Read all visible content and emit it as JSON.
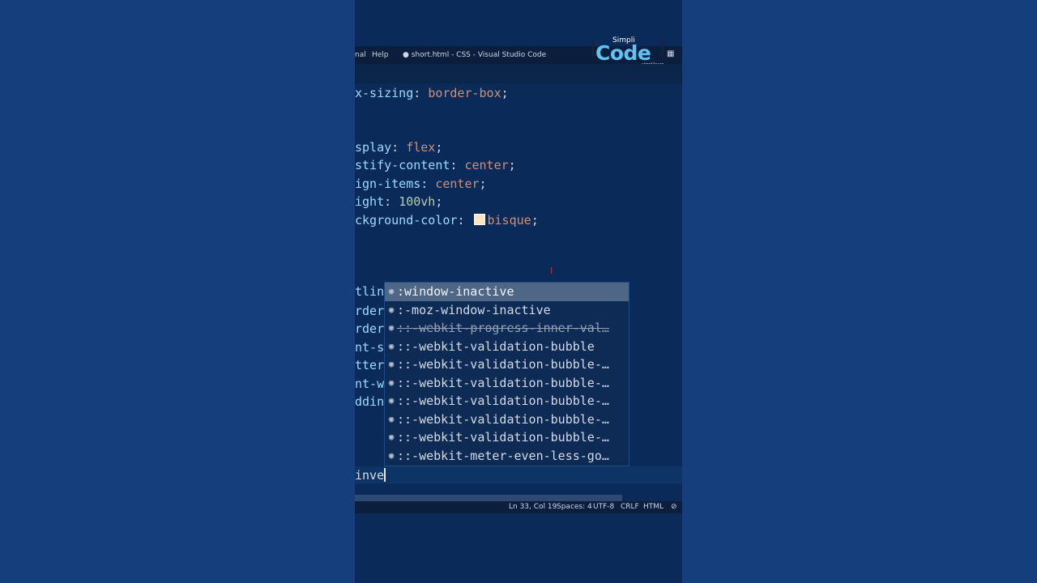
{
  "titlebar": {
    "menu_terminal": "nal",
    "menu_help": "Help",
    "window_title": "● short.html - CSS - Visual Studio Code"
  },
  "logo": {
    "simpli": "Simpli",
    "code": "Code",
    "tagline": "simplilearn"
  },
  "editor": {
    "lines": [
      {
        "prop": "x-sizing",
        "value": "border-box"
      },
      {
        "prop": "splay",
        "value": "flex"
      },
      {
        "prop": "stify-content",
        "value": "center"
      },
      {
        "prop": "ign-items",
        "value": "center"
      },
      {
        "prop": "ight",
        "value": "100vh"
      },
      {
        "prop": "ckground-color",
        "value": "bisque",
        "swatch": "#ffe4c4"
      }
    ],
    "hidden_props": [
      "tlin",
      "rder",
      "rder",
      "nt-s",
      "tter",
      "nt-w",
      "ddin"
    ],
    "current_input": "inve"
  },
  "suggestions": [
    {
      "label": ":window-inactive",
      "selected": true
    },
    {
      "label": ":-moz-window-inactive"
    },
    {
      "label": "::-webkit-progress-inner-val…",
      "deprecated": true
    },
    {
      "label": "::-webkit-validation-bubble"
    },
    {
      "label": "::-webkit-validation-bubble-…"
    },
    {
      "label": "::-webkit-validation-bubble-…"
    },
    {
      "label": "::-webkit-validation-bubble-…"
    },
    {
      "label": "::-webkit-validation-bubble-…"
    },
    {
      "label": "::-webkit-validation-bubble-…"
    },
    {
      "label": "::-webkit-meter-even-less-go…"
    }
  ],
  "statusbar": {
    "position": "Ln 33, Col 19",
    "spaces": "Spaces: 4",
    "encoding": "UTF-8",
    "eol": "CRLF",
    "language": "HTML",
    "no_problems": "⊘"
  },
  "icons": {
    "suggestion": "class-icon",
    "window_controls": "layout-icon"
  },
  "colors": {
    "background": "#153f7c",
    "editor": "#0a2a5a",
    "selected_suggestion": "#4f6787",
    "swatch": "#ffe4c4"
  }
}
